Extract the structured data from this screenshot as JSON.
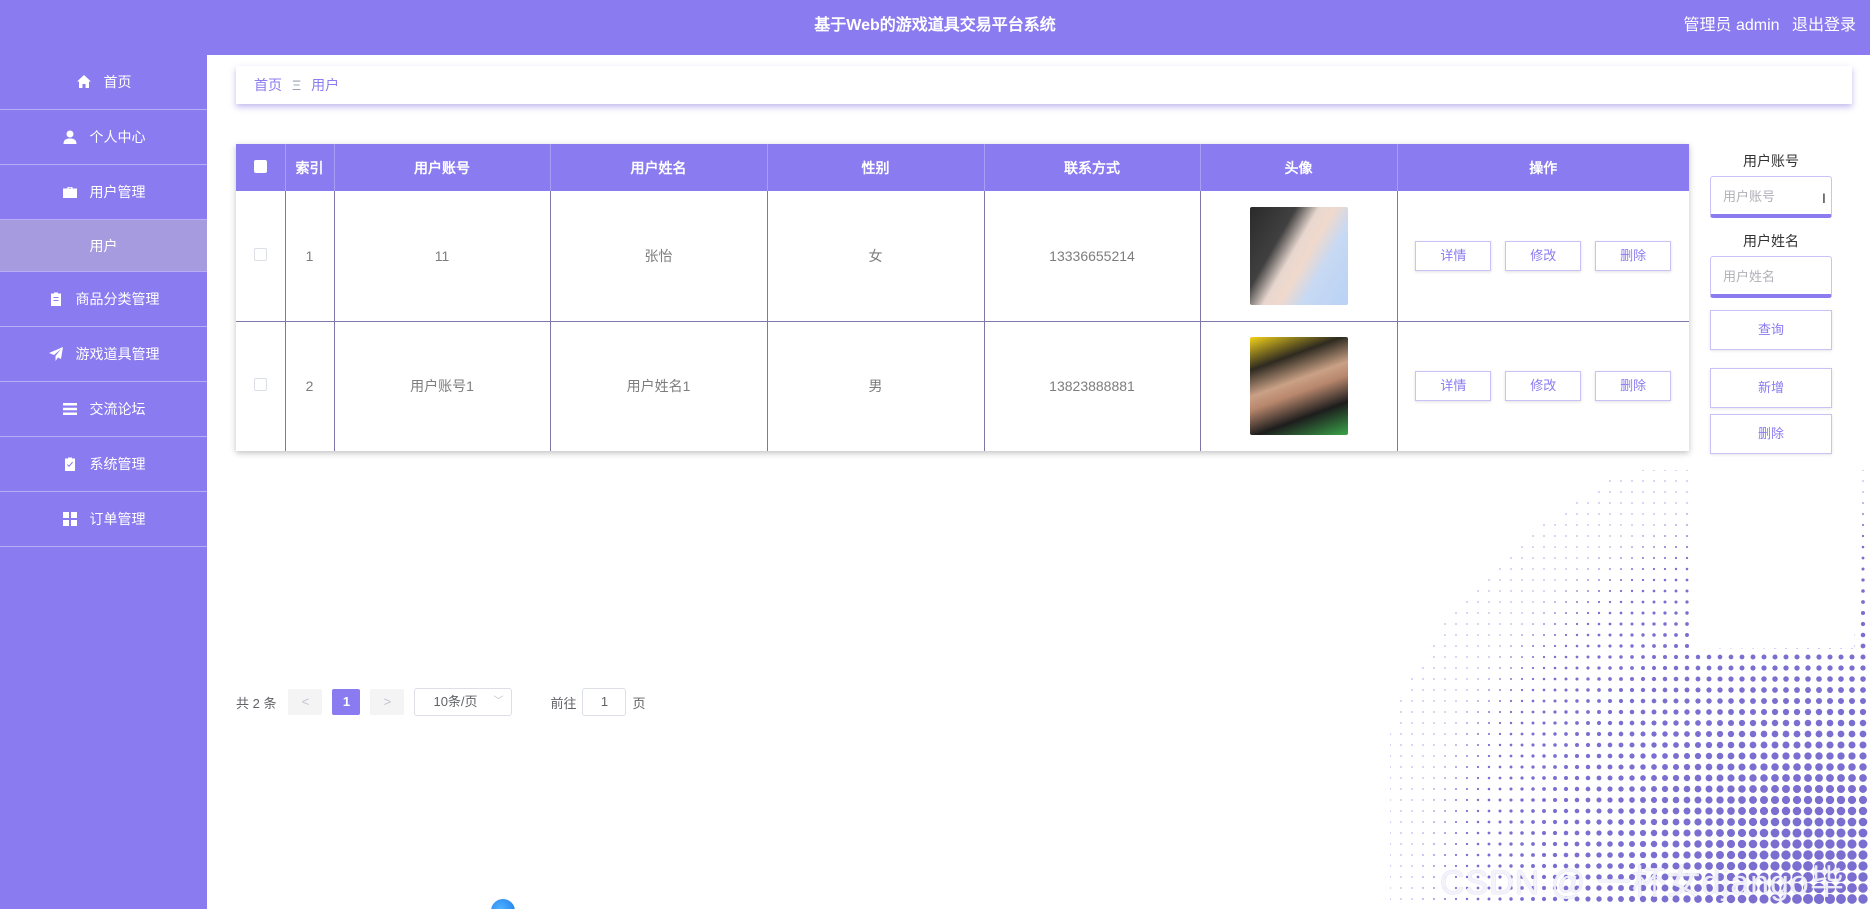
{
  "header": {
    "title": "基于Web的游戏道具交易平台系统",
    "user_label": "管理员 admin",
    "logout_label": "退出登录"
  },
  "sidebar": {
    "items": [
      {
        "label": "首页",
        "icon": "home-icon"
      },
      {
        "label": "个人中心",
        "icon": "user-icon"
      },
      {
        "label": "用户管理",
        "icon": "briefcase-icon"
      },
      {
        "label": "用户",
        "icon": ""
      },
      {
        "label": "商品分类管理",
        "icon": "clipboard-icon"
      },
      {
        "label": "游戏道具管理",
        "icon": "send-icon"
      },
      {
        "label": "交流论坛",
        "icon": "list-icon"
      },
      {
        "label": "系统管理",
        "icon": "clipboard-check-icon"
      },
      {
        "label": "订单管理",
        "icon": "grid-icon"
      }
    ],
    "active_color": "#a59bde"
  },
  "breadcrumb": {
    "home": "首页",
    "separator": "Ξ",
    "current": "用户"
  },
  "table": {
    "headers": [
      "",
      "索引",
      "用户账号",
      "用户姓名",
      "性别",
      "联系方式",
      "头像",
      "操作"
    ],
    "rows": [
      {
        "index": "1",
        "account": "11",
        "name": "张怡",
        "gender": "女",
        "phone": "13336655214",
        "avatar": "avatar-female"
      },
      {
        "index": "2",
        "account": "用户账号1",
        "name": "用户姓名1",
        "gender": "男",
        "phone": "13823888881",
        "avatar": "avatar-male"
      }
    ],
    "actions": {
      "detail": "详情",
      "edit": "修改",
      "delete": "删除"
    }
  },
  "search": {
    "account_label": "用户账号",
    "account_placeholder": "用户账号",
    "name_label": "用户姓名",
    "name_placeholder": "用户姓名",
    "query_button": "查询",
    "add_button": "新增",
    "delete_button": "删除"
  },
  "pagination": {
    "total": "共 2 条",
    "prev": "<",
    "current_page": "1",
    "next": ">",
    "page_size": "10条/页",
    "goto_label": "前往",
    "goto_value": "1",
    "page_suffix": "页"
  },
  "watermark": "CSDN @ 一杯女django毕设",
  "theme": {
    "accent": "#8a7bf0"
  }
}
